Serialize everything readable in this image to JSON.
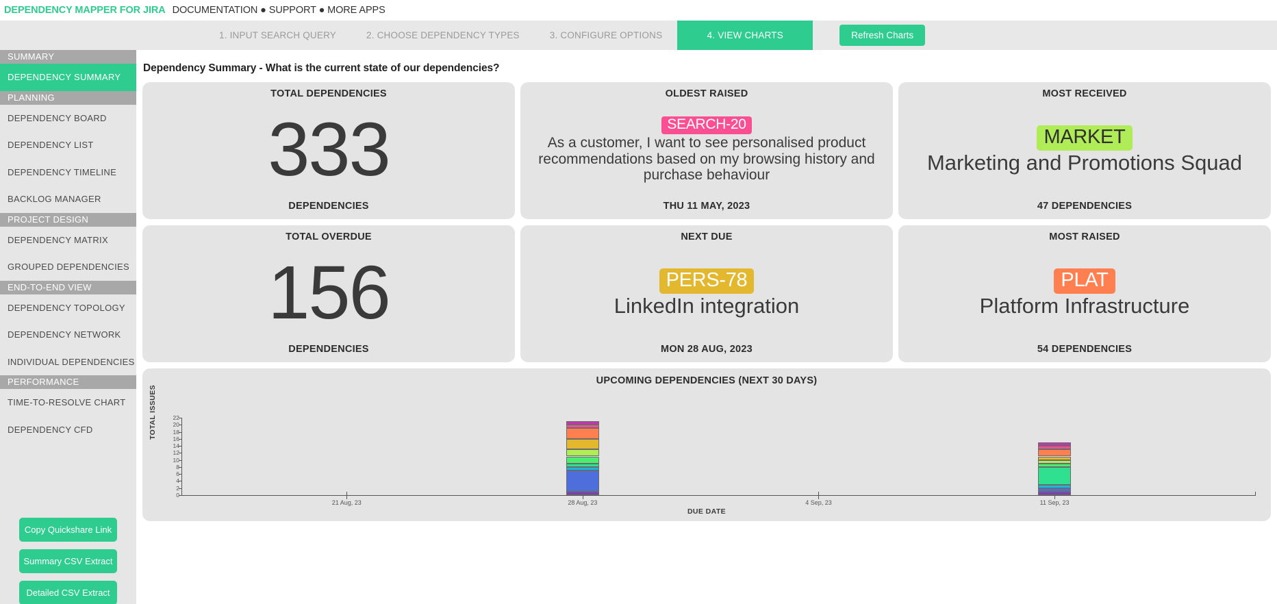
{
  "brand": {
    "title": "DEPENDENCY MAPPER FOR JIRA",
    "links": "DOCUMENTATION ● SUPPORT ● MORE APPS",
    "accent": "#2ECC8F"
  },
  "steps": [
    {
      "label": "1. INPUT SEARCH QUERY",
      "active": false
    },
    {
      "label": "2. CHOOSE DEPENDENCY TYPES",
      "active": false
    },
    {
      "label": "3. CONFIGURE OPTIONS",
      "active": false
    },
    {
      "label": "4. VIEW CHARTS",
      "active": true
    }
  ],
  "refresh_button": "Refresh Charts",
  "sidebar": {
    "items": [
      {
        "type": "group",
        "label": "SUMMARY"
      },
      {
        "type": "item",
        "label": "DEPENDENCY SUMMARY",
        "selected": true
      },
      {
        "type": "group",
        "label": "PLANNING"
      },
      {
        "type": "item",
        "label": "DEPENDENCY BOARD",
        "selected": false
      },
      {
        "type": "item",
        "label": "DEPENDENCY LIST",
        "selected": false
      },
      {
        "type": "item",
        "label": "DEPENDENCY TIMELINE",
        "selected": false
      },
      {
        "type": "item",
        "label": "BACKLOG MANAGER",
        "selected": false
      },
      {
        "type": "group",
        "label": "PROJECT DESIGN"
      },
      {
        "type": "item",
        "label": "DEPENDENCY MATRIX",
        "selected": false
      },
      {
        "type": "item",
        "label": "GROUPED DEPENDENCIES",
        "selected": false
      },
      {
        "type": "group",
        "label": "END-TO-END VIEW"
      },
      {
        "type": "item",
        "label": "DEPENDENCY TOPOLOGY",
        "selected": false
      },
      {
        "type": "item",
        "label": "DEPENDENCY NETWORK",
        "selected": false
      },
      {
        "type": "item",
        "label": "INDIVIDUAL DEPENDENCIES",
        "selected": false
      },
      {
        "type": "group",
        "label": "PERFORMANCE"
      },
      {
        "type": "item",
        "label": "TIME-TO-RESOLVE CHART",
        "selected": false
      },
      {
        "type": "item",
        "label": "DEPENDENCY CFD",
        "selected": false
      }
    ],
    "actions": [
      {
        "label": "Copy Quickshare Link"
      },
      {
        "label": "Summary CSV Extract"
      },
      {
        "label": "Detailed CSV Extract"
      }
    ]
  },
  "page": {
    "title": "Dependency Summary - What is the current state of our dependencies?"
  },
  "cards": [
    {
      "name": "total-dependencies",
      "title": "TOTAL DEPENDENCIES",
      "value": "333",
      "footer": "DEPENDENCIES"
    },
    {
      "name": "oldest-raised",
      "title": "OLDEST RAISED",
      "badge": "SEARCH-20",
      "badge_color": "#FB4F93",
      "badge_text_color": "#ffffff",
      "summary": "As a customer, I want to see personalised product recommendations based on my browsing history and purchase behaviour",
      "footer": "THU 11 MAY, 2023"
    },
    {
      "name": "most-received",
      "title": "MOST RECEIVED",
      "badge": "MARKET",
      "badge_color": "#B0EB58",
      "badge_text_color": "#2f2f2f",
      "summary": "Marketing and Promotions Squad",
      "footer": "47 DEPENDENCIES"
    },
    {
      "name": "total-overdue",
      "title": "TOTAL OVERDUE",
      "value": "156",
      "footer": "DEPENDENCIES"
    },
    {
      "name": "next-due",
      "title": "NEXT DUE",
      "badge": "PERS-78",
      "badge_color": "#E3B72E",
      "badge_text_color": "#ffffff",
      "summary": "LinkedIn integration",
      "footer": "MON 28 AUG, 2023"
    },
    {
      "name": "most-raised",
      "title": "MOST RAISED",
      "badge": "PLAT",
      "badge_color": "#FF7F50",
      "badge_text_color": "#ffffff",
      "summary": "Platform Infrastructure",
      "footer": "54 DEPENDENCIES"
    }
  ],
  "chart_data": {
    "type": "bar",
    "stacked": true,
    "title": "UPCOMING DEPENDENCIES (NEXT 30 DAYS)",
    "xlabel": "DUE DATE",
    "ylabel": "TOTAL ISSUES",
    "ylim": [
      0,
      22
    ],
    "yticks": [
      0,
      2,
      4,
      6,
      8,
      10,
      12,
      14,
      16,
      18,
      20,
      22
    ],
    "xticks": [
      "21 Aug, 23",
      "28 Aug, 23",
      "4 Sep, 23",
      "11 Sep, 23"
    ],
    "grid": false,
    "legend": "none",
    "bars": [
      {
        "x": "28 Aug, 23",
        "total": 21,
        "segments": [
          {
            "color": "#7B3FB5",
            "value": 1
          },
          {
            "color": "#4E6FDB",
            "value": 6
          },
          {
            "color": "#1CB8D9",
            "value": 1
          },
          {
            "color": "#2EE08F",
            "value": 1
          },
          {
            "color": "#4CEE6E",
            "value": 2
          },
          {
            "color": "#B0EB58",
            "value": 2
          },
          {
            "color": "#E3B72E",
            "value": 3
          },
          {
            "color": "#FF7F50",
            "value": 3
          },
          {
            "color": "#FB4F93",
            "value": 1
          },
          {
            "color": "#C038B0",
            "value": 1
          }
        ]
      },
      {
        "x": "11 Sep, 23",
        "total": 15,
        "segments": [
          {
            "color": "#7B3FB5",
            "value": 1
          },
          {
            "color": "#4E6FDB",
            "value": 1
          },
          {
            "color": "#1CB8D9",
            "value": 1
          },
          {
            "color": "#2EE08F",
            "value": 5
          },
          {
            "color": "#4CEE6E",
            "value": 1
          },
          {
            "color": "#B0EB58",
            "value": 1
          },
          {
            "color": "#E3B72E",
            "value": 1
          },
          {
            "color": "#FF7F50",
            "value": 2
          },
          {
            "color": "#FB4F93",
            "value": 1
          },
          {
            "color": "#C038B0",
            "value": 1
          }
        ]
      }
    ]
  }
}
